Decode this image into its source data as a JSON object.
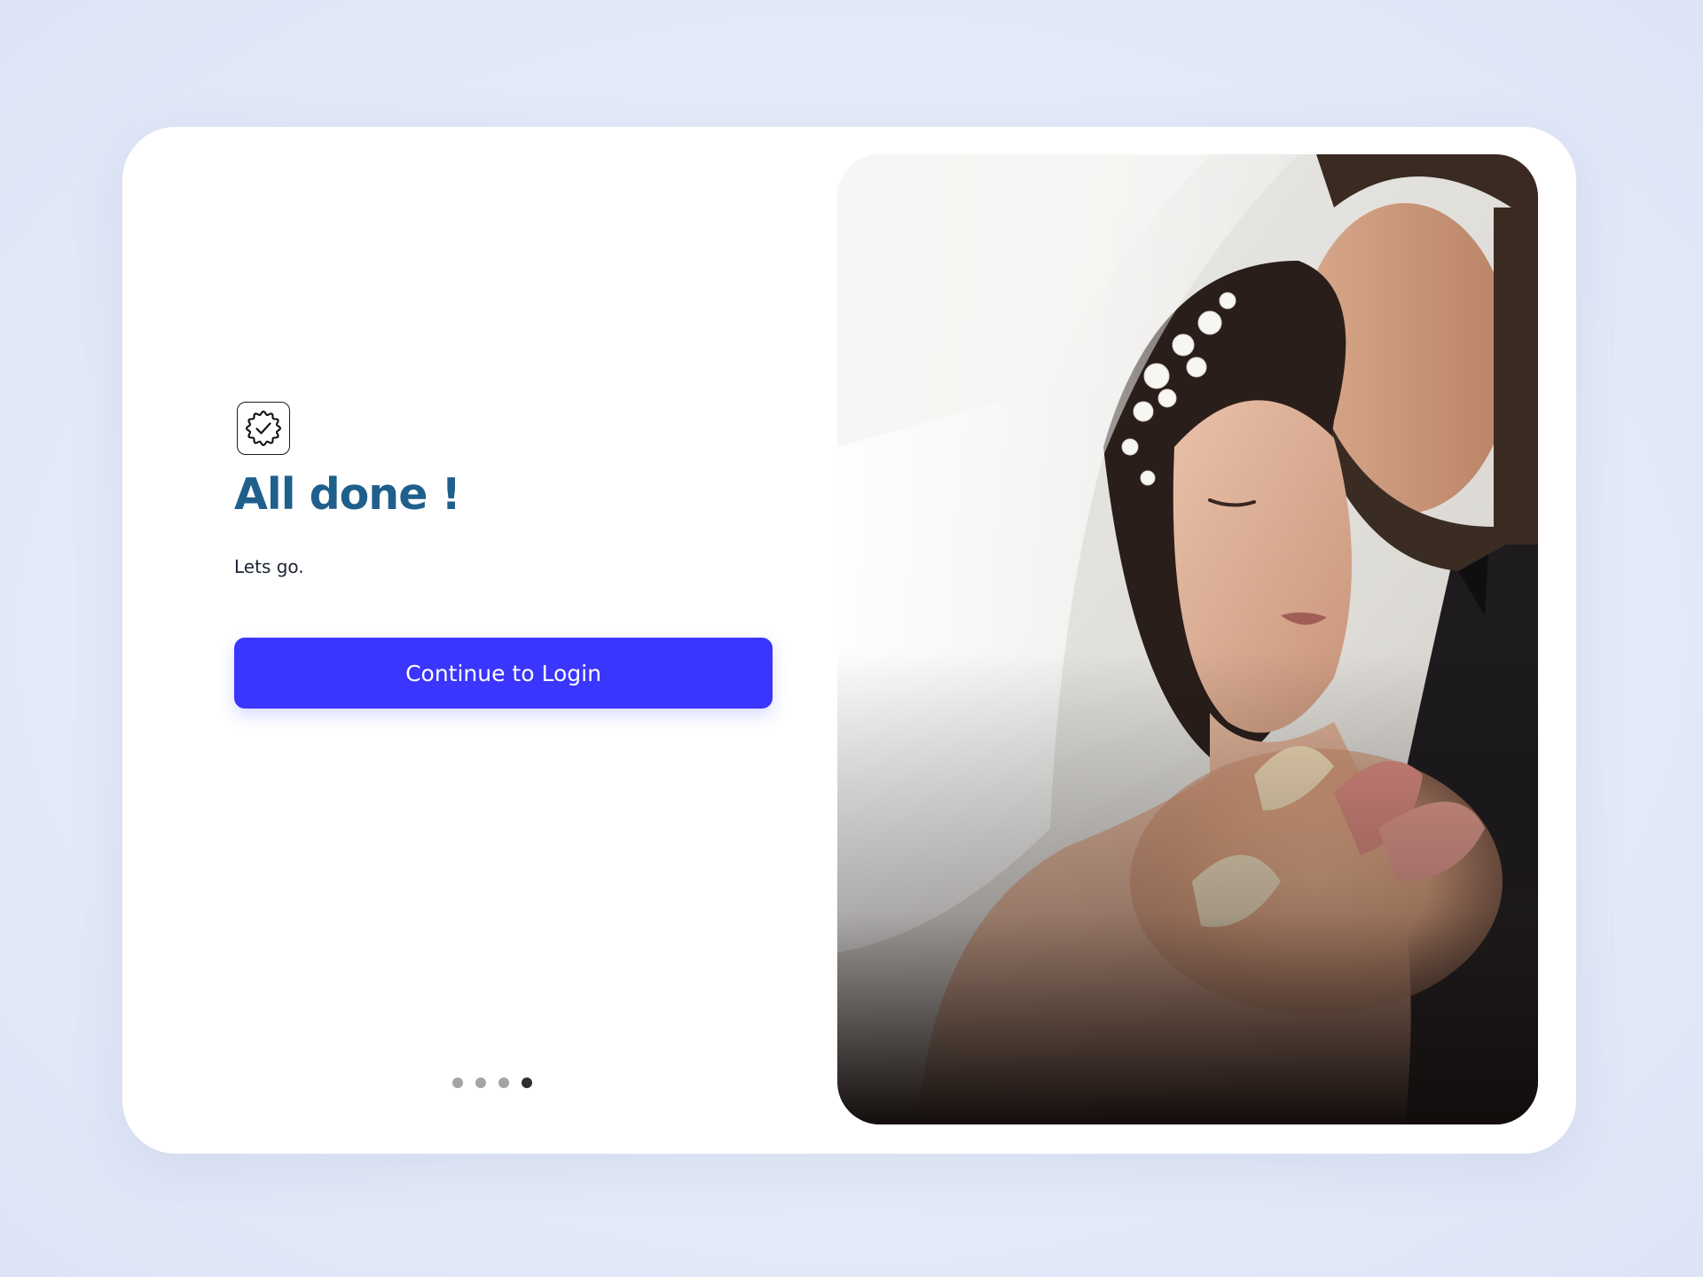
{
  "completion": {
    "badge_icon": "verified-badge-icon",
    "title": "All done !",
    "subtitle": "Lets go.",
    "cta_label": "Continue to Login"
  },
  "pagination": {
    "total": 4,
    "active_index": 3
  },
  "hero": {
    "image": "couple-photo"
  },
  "colors": {
    "title": "#1f5f8c",
    "cta_background": "#3a36fd",
    "dot_inactive": "#a4a4a4",
    "dot_active": "#2f2f2f"
  }
}
